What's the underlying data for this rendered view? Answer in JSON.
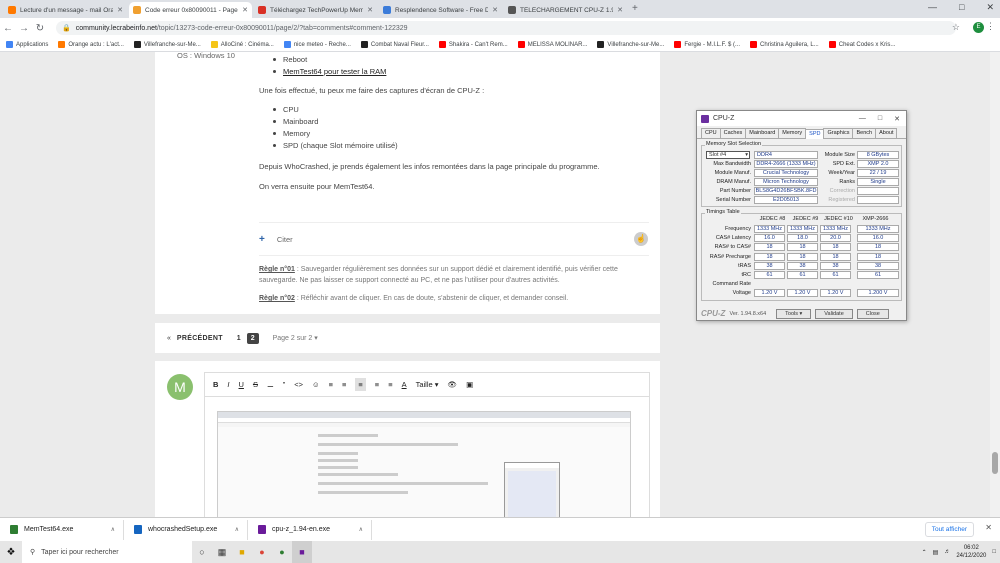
{
  "browser": {
    "tabs": [
      {
        "title": "Lecture d'un message - mail Ora",
        "favicon_color": "#ff7900",
        "active": false
      },
      {
        "title": "Code erreur 0x80090011 - Page",
        "favicon_color": "#f0a030",
        "active": true
      },
      {
        "title": "Téléchargez TechPowerUp Mem",
        "favicon_color": "#d93025",
        "active": false
      },
      {
        "title": "Resplendence Software - Free D",
        "favicon_color": "#3c7cd9",
        "active": false
      },
      {
        "title": "TÉLÉCHARGEMENT CPU-Z 1.94",
        "favicon_color": "#555555",
        "active": false
      }
    ],
    "url_host": "community.lecrabeinfo.net",
    "url_path": "/topic/13273-code-erreur-0x80090011/page/2/?tab=comments#comment-122329",
    "profile_initial": "E",
    "bookmarks": [
      {
        "label": "Applications",
        "color": "#4285f4"
      },
      {
        "label": "Orange actu : L'act...",
        "color": "#ff7900"
      },
      {
        "label": "Villefranche-sur-Me...",
        "color": "#222222"
      },
      {
        "label": "AlloCiné : Cinéma...",
        "color": "#f5c518"
      },
      {
        "label": "nice meteo - Reche...",
        "color": "#4285f4"
      },
      {
        "label": "Combat Naval Fleur...",
        "color": "#222222"
      },
      {
        "label": "Shakira - Can't Rem...",
        "color": "#ff0000"
      },
      {
        "label": "MELISSA MOLINAR...",
        "color": "#ff0000"
      },
      {
        "label": "Villefranche-sur-Me...",
        "color": "#222222"
      },
      {
        "label": "Fergie - M.I.L.F. $ (...",
        "color": "#ff0000"
      },
      {
        "label": "Christina Aguilera, L...",
        "color": "#ff0000"
      },
      {
        "label": "Cheat Codes x Kris...",
        "color": "#ff0000"
      }
    ]
  },
  "post": {
    "os_line": "OS : Windows 10",
    "bullets_top": [
      "Reboot",
      "MemTest64 pour tester la RAM"
    ],
    "intro": "Une fois effectué, tu peux me faire des captures d'écran de CPU-Z :",
    "bullets": [
      "CPU",
      "Mainboard",
      "Memory",
      "SPD (chaque Slot mémoire utilisé)"
    ],
    "para1": "Depuis WhoCrashed, je prends également les infos remontées dans la page principale du programme.",
    "para2": "On verra ensuite pour MemTest64.",
    "quote_label": "Citer",
    "rule1_title": "Règle n°01",
    "rule1_text": " : Sauvegarder régulièrement ses données sur un support dédié et clairement identifié, puis vérifier cette sauvegarde. Ne pas laisser ce support connecté au PC, et ne pas l'utiliser pour d'autres activités.",
    "rule2_title": "Règle n°02",
    "rule2_text": " : Réfléchir avant de cliquer. En cas de doute, s'abstenir de cliquer, et demander conseil."
  },
  "pagination": {
    "prev": "PRÉCÉDENT",
    "pages": [
      "1",
      "2"
    ],
    "current": "2",
    "of": "Page 2 sur 2"
  },
  "reply": {
    "avatar_initial": "M",
    "toolbar_items": [
      "B",
      "I",
      "U",
      "S",
      "Taille"
    ]
  },
  "cpuz": {
    "title": "CPU-Z",
    "tabs": [
      "CPU",
      "Caches",
      "Mainboard",
      "Memory",
      "SPD",
      "Graphics",
      "Bench",
      "About"
    ],
    "active_tab": "SPD",
    "group_slot": "Memory Slot Selection",
    "slot": "Slot #4",
    "type": "DDR4",
    "module_size_label": "Module Size",
    "module_size": "8 GBytes",
    "max_bw_label": "Max Bandwidth",
    "max_bw": "DDR4-2666 (1333 MHz)",
    "spd_ext_label": "SPD Ext.",
    "spd_ext": "XMP 2.0",
    "manuf_label": "Module Manuf.",
    "manuf": "Crucial Technology",
    "week_label": "Week/Year",
    "week": "22 / 19",
    "dram_label": "DRAM Manuf.",
    "dram": "Micron Technology",
    "ranks_label": "Ranks",
    "ranks": "Single",
    "part_label": "Part Number",
    "part": "BLS8G4D26BFSBK.8FD",
    "correction_label": "Correction",
    "serial_label": "Serial Number",
    "serial": "E2D05013",
    "registered_label": "Registered",
    "group_timings": "Timings Table",
    "timing_headers": [
      "JEDEC #8",
      "JEDEC #9",
      "JEDEC #10",
      "XMP-2666"
    ],
    "timing_rows": [
      {
        "label": "Frequency",
        "values": [
          "1333 MHz",
          "1333 MHz",
          "1333 MHz",
          "1333 MHz"
        ]
      },
      {
        "label": "CAS# Latency",
        "values": [
          "16.0",
          "18.0",
          "20.0",
          "16.0"
        ]
      },
      {
        "label": "RAS# to CAS#",
        "values": [
          "18",
          "18",
          "18",
          "18"
        ]
      },
      {
        "label": "RAS# Precharge",
        "values": [
          "18",
          "18",
          "18",
          "18"
        ]
      },
      {
        "label": "tRAS",
        "values": [
          "38",
          "38",
          "38",
          "38"
        ]
      },
      {
        "label": "tRC",
        "values": [
          "61",
          "61",
          "61",
          "61"
        ]
      },
      {
        "label": "Command Rate",
        "values": [
          "",
          "",
          "",
          ""
        ]
      },
      {
        "label": "Voltage",
        "values": [
          "1.20 V",
          "1.20 V",
          "1.20 V",
          "1.200 V"
        ]
      }
    ],
    "logo": "CPU-Z",
    "version": "Ver. 1.94.8.x64",
    "tools_btn": "Tools",
    "validate_btn": "Validate",
    "close_btn": "Close"
  },
  "downloads": {
    "items": [
      {
        "name": "MemTest64.exe",
        "color": "#2e7d32"
      },
      {
        "name": "whocrashedSetup.exe",
        "color": "#1565c0"
      },
      {
        "name": "cpu-z_1.94-en.exe",
        "color": "#6a1b9a"
      }
    ],
    "show_all": "Tout afficher"
  },
  "taskbar": {
    "search_placeholder": "Taper ici pour rechercher",
    "time": "06:02",
    "date": "24/12/2020"
  }
}
